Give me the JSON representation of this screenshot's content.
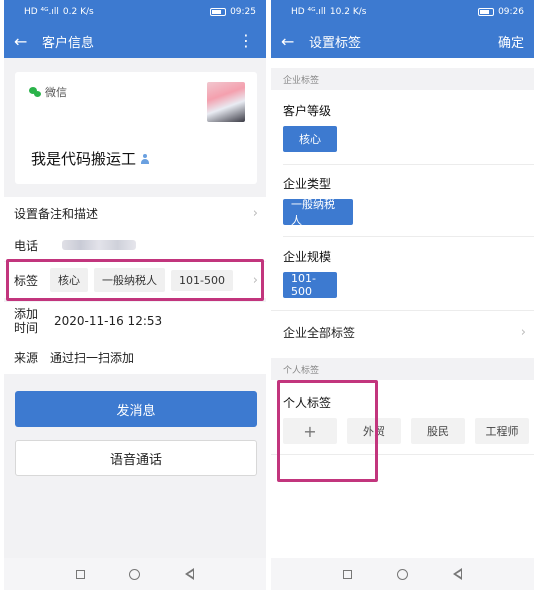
{
  "left": {
    "status_bar": {
      "carrier": "HD ⁴ᴳ.ıll",
      "speed": "0.2 K/s",
      "time": "09:25"
    },
    "app_bar": {
      "title": "客户信息"
    },
    "profile": {
      "source_app": "微信",
      "nickname": "我是代码搬运工"
    },
    "rows": {
      "remark_label": "设置备注和描述",
      "phone_label": "电话",
      "tags_label": "标签",
      "tags": [
        "核心",
        "一般纳税人",
        "101-500"
      ],
      "added_time_label": "添加\n时间",
      "added_time_value": "2020-11-16 12:53",
      "source_label": "来源",
      "source_value": "通过扫一扫添加"
    },
    "buttons": {
      "send_message": "发消息",
      "voice_call": "语音通话"
    }
  },
  "right": {
    "status_bar": {
      "carrier": "HD ⁴ᴳ.ıll",
      "speed": "10.2 K/s",
      "time": "09:26"
    },
    "app_bar": {
      "title": "设置标签",
      "confirm": "确定"
    },
    "enterprise_section": "企业标签",
    "groups": [
      {
        "title": "客户等级",
        "selected": "核心"
      },
      {
        "title": "企业类型",
        "selected": "一般纳税人"
      },
      {
        "title": "企业规模",
        "selected": "101-500"
      }
    ],
    "all_tags_label": "企业全部标签",
    "personal_section": "个人标签",
    "personal_title": "个人标签",
    "personal_tags": [
      "外贸",
      "股民",
      "工程师"
    ],
    "add_symbol": "+"
  },
  "colors": {
    "primary": "#3d7ad0",
    "highlight": "#c2357d",
    "wechat_green": "#2bb34a"
  },
  "icons": [
    "back-arrow-icon",
    "more-vert-icon",
    "wechat-icon",
    "person-icon",
    "chevron-right-icon",
    "plus-icon"
  ]
}
